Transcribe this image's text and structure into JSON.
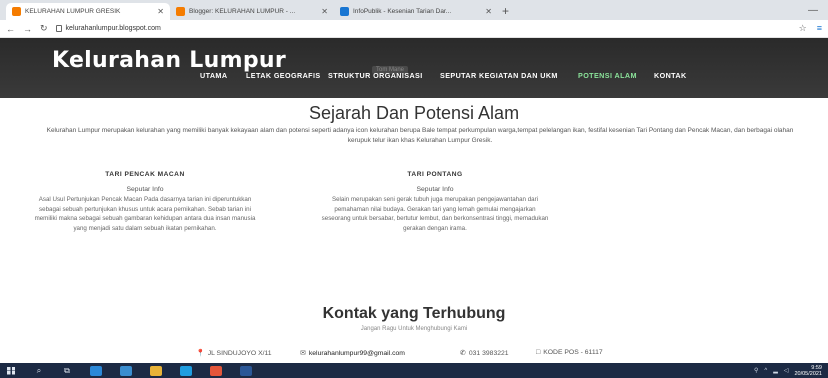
{
  "browser": {
    "tabs": [
      {
        "title": "KELURAHAN LUMPUR GRESIK",
        "favicon": "blogger-favicon",
        "active": true
      },
      {
        "title": "Blogger: KELURAHAN LUMPUR - ...",
        "favicon": "blogger-favicon",
        "active": false
      },
      {
        "title": "InfoPublik - Kesenian Tarian Dar...",
        "favicon": "infopublik-favicon",
        "active": false
      }
    ],
    "new_tab": "+",
    "url": "kelurahanlumpur.blogspot.com"
  },
  "site": {
    "brand": "Kelurahan Lumpur",
    "ghost_tooltip": "Tom Mane",
    "nav": [
      "UTAMA",
      "LETAK GEOGRAFIS",
      "STRUKTUR ORGANISASI",
      "SEPUTAR KEGIATAN DAN UKM",
      "POTENSI ALAM",
      "KONTAK"
    ],
    "active_nav": "POTENSI ALAM",
    "accent_color": "#8be39a"
  },
  "main": {
    "title": "Sejarah Dan Potensi Alam",
    "lead": "Kelurahan Lumpur merupakan kelurahan yang memiliki banyak kekayaan alam dan potensi seperti adanya icon kelurahan berupa Bale tempat perkumpulan warga,tempat pelelangan ikan, festifal kesenian Tari Pontang dan Pencak Macan, dan berbagai olahan kerupuk telur ikan khas Kelurahan Lumpur Gresik.",
    "sections": [
      {
        "heading": "TARI PENCAK MACAN",
        "sub": "Seputar Info",
        "text": "Asal Usul Pertunjukan Pencak Macan Pada dasarnya tarian ini diperuntukkan sebagai sebuah pertunjukan khusus untuk acara pernikahan. Sebab tarian ini memiliki makna sebagai sebuah gambaran kehidupan antara dua insan manusia yang menjadi satu dalam sebuah ikatan pernikahan."
      },
      {
        "heading": "TARI PONTANG",
        "sub": "Seputar Info",
        "text": "Selain merupakan seni gerak tubuh juga merupakan pengejawantahan dari pemahaman nilai budaya. Gerakan tari yang lemah gemulai mengajarkan seseorang untuk bersabar, bertutur lembut, dan berkonsentrasi tinggi, memadukan gerakan dengan irama."
      }
    ]
  },
  "contact": {
    "title": "Kontak yang Terhubung",
    "subtitle": "Jangan Ragu Untuk Menghubungi Kami",
    "address": "JL SINDUJOYO X/11",
    "email": "kelurahanlumpur99@gmail.com",
    "phone": "031 3983221",
    "postal": "KODE POS - 61117"
  },
  "taskbar": {
    "time": "9:59",
    "date": "20/05/2021"
  }
}
